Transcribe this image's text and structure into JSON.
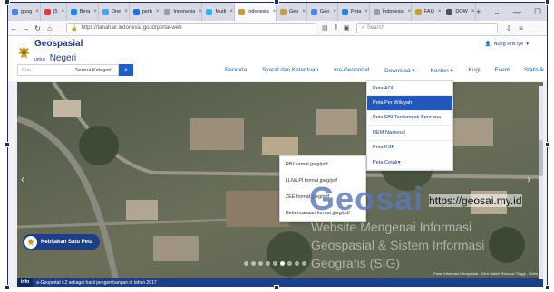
{
  "browser": {
    "tabs": [
      {
        "label": "goog",
        "color": "#4285f4",
        "active": false
      },
      {
        "label": "(5",
        "color": "#e53935",
        "active": false
      },
      {
        "label": "Bera",
        "color": "#1e88e5",
        "active": false
      },
      {
        "label": "One",
        "color": "#42a5f5",
        "active": false
      },
      {
        "label": "perb",
        "color": "#1a73e8",
        "active": false
      },
      {
        "label": "Indonesia",
        "color": "#9e9e9e",
        "active": false
      },
      {
        "label": "Mudi",
        "color": "#29b6f6",
        "active": false
      },
      {
        "label": "Indonesia",
        "color": "#c89b3c",
        "active": true
      },
      {
        "label": "Geo",
        "color": "#c89b3c",
        "active": false
      },
      {
        "label": "Geo",
        "color": "#4285f4",
        "active": false
      },
      {
        "label": "Peta",
        "color": "#1e88e5",
        "active": false
      },
      {
        "label": "Indonesia",
        "color": "#9e9e9e",
        "active": false
      },
      {
        "label": "FAQ",
        "color": "#c89b3c",
        "active": false
      },
      {
        "label": "DOW",
        "color": "#455a64",
        "active": false
      }
    ],
    "new_tab": "+",
    "url": "https://tanahair.indonesia.go.id/portal-web",
    "search_placeholder": "Search"
  },
  "site": {
    "logo_title": "Geospasial",
    "logo_small": "untuk",
    "logo_sub": "Negeri",
    "user": "Nung Pris iye",
    "search_placeholder": "Cari",
    "category": "Semua Kategori",
    "menu": [
      "Beranda",
      "Syarat dan Ketentuan",
      "Ina-Geoportal",
      "Download",
      "Konten",
      "Kugi",
      "Event",
      "Statistik"
    ]
  },
  "download_menu": [
    "Peta AOI",
    "Peta Per Wilayah",
    "Peta RBI Terdampak Bencana",
    "DEM Nasional",
    "Peta KSP",
    "Peta Cetak"
  ],
  "download_highlight": "Peta Per Wilayah",
  "submenu": [
    "RBI format jpeg/pdf",
    "LLN/LPI format jpeg/pdf",
    "ZEE format jpeg/pdf",
    "Kebencanaan format jpeg/pdf"
  ],
  "hero": {
    "ksp_label": "Kebijakan Satu Peta",
    "info_label": "Info",
    "info_text": "a-Geoportal v.2 sebagai hasil pengembangan di tahun 2017",
    "credit": "Pusat Informasi Geospasial - Citra Satelit Resolusi Tinggi - Ortho",
    "slide_count": 9,
    "active_slide": 5
  },
  "watermark": {
    "brand": "Geosai",
    "url": "https://geosai.my.id",
    "line1": "Website Mengenai Informasi",
    "line2": "Geospasial & Sistem Informasi",
    "line3": "Geografis (SIG)"
  }
}
